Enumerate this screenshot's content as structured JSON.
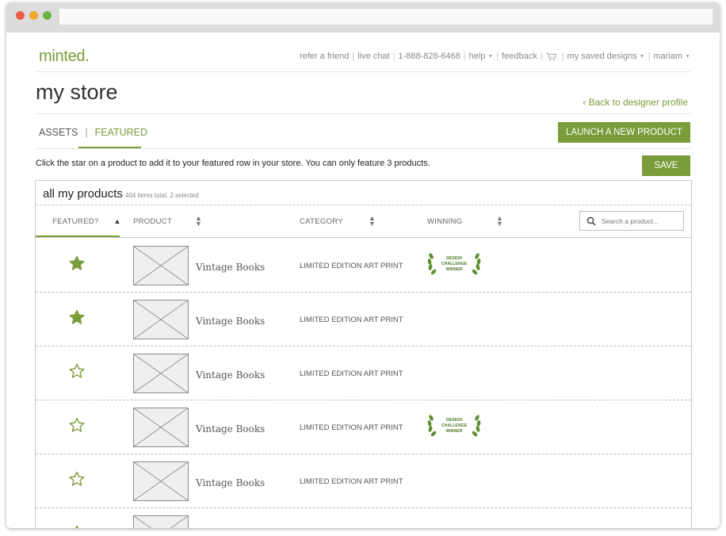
{
  "colors": {
    "accent": "#7a9c3a",
    "close": "#ee5b4b",
    "minimize": "#f3a72c",
    "maximize": "#68b545"
  },
  "header": {
    "logo": "minted.",
    "nav": {
      "refer": "refer a friend",
      "chat": "live chat",
      "phone": "1-888-828-6468",
      "help": "help",
      "feedback": "feedback",
      "cart_icon": "cart-icon",
      "saved": "my saved designs",
      "user": "mariam"
    }
  },
  "page": {
    "title": "my store",
    "back_link": "Back to designer profile",
    "tabs": {
      "assets": "ASSETS",
      "featured": "FEATURED",
      "divider": "|"
    },
    "launch_button": "LAUNCH A NEW PRODUCT",
    "intro": "Click the star on a product to add it to your featured row in your store. You can only feature 3 products.",
    "save_button": "SAVE"
  },
  "products_panel": {
    "title": "all my products",
    "count": "404 items total, 2 selected",
    "columns": {
      "featured": "FEATURED?",
      "product": "PRODUCT",
      "category": "CATEGORY",
      "winning": "WINNING"
    },
    "search_placeholder": "Search a product...",
    "badge": {
      "line1": "DESIGN",
      "line2": "CHALLENGE",
      "line3": "WINNER"
    },
    "rows": [
      {
        "featured": true,
        "name": "Vintage Books",
        "category": "LIMITED EDITION ART PRINT",
        "winner": true
      },
      {
        "featured": true,
        "name": "Vintage Books",
        "category": "LIMITED EDITION ART PRINT",
        "winner": false
      },
      {
        "featured": false,
        "name": "Vintage Books",
        "category": "LIMITED EDITION ART PRINT",
        "winner": false
      },
      {
        "featured": false,
        "name": "Vintage Books",
        "category": "LIMITED EDITION ART PRINT",
        "winner": true
      },
      {
        "featured": false,
        "name": "Vintage Books",
        "category": "LIMITED EDITION ART PRINT",
        "winner": false
      },
      {
        "featured": false,
        "name": "",
        "category": "",
        "winner": false
      }
    ]
  }
}
